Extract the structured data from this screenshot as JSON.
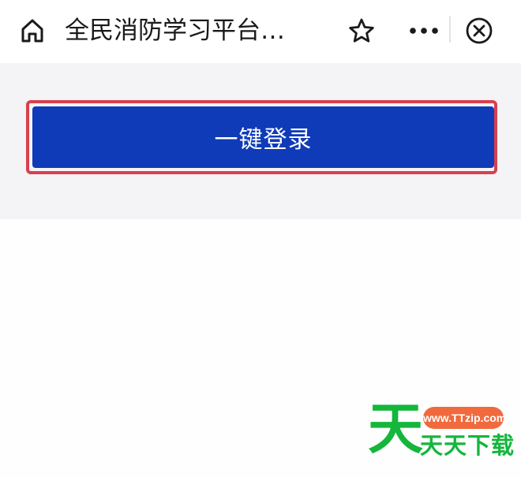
{
  "header": {
    "title": "全民消防学习平台…",
    "icons": {
      "home": "home-icon",
      "star": "star-icon",
      "more": "more-icon",
      "close": "close-icon"
    }
  },
  "main": {
    "login_button_label": "一键登录"
  },
  "watermark": {
    "big_char": "天",
    "url": "www.TTzip.com",
    "text": "天天下载"
  },
  "colors": {
    "accent": "#0f3bb8",
    "highlight": "#d8404e",
    "band": "#f4f3f6",
    "watermark_green": "#14b63c",
    "watermark_orange": "#f06a3e"
  }
}
